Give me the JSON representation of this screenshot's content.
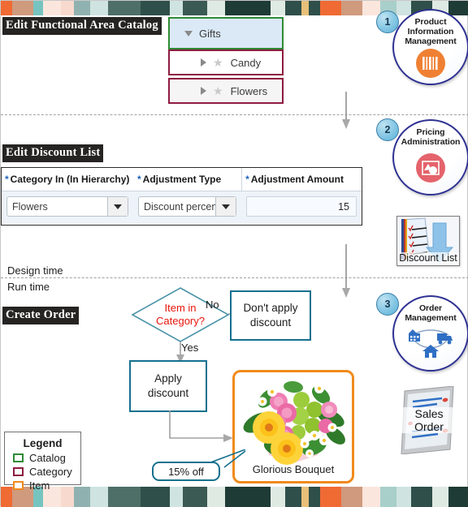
{
  "sections": {
    "catalog_heading": "Edit Functional Area Catalog",
    "discount_heading": "Edit Discount List",
    "order_heading": "Create Order",
    "design_time_label": "Design time",
    "run_time_label": "Run time"
  },
  "tree": {
    "rows": [
      {
        "label": "Gifts",
        "twisty": "down",
        "starred": false,
        "level": 0,
        "kind": "catalog"
      },
      {
        "label": "Candy",
        "twisty": "right",
        "starred": true,
        "level": 1,
        "kind": "category"
      },
      {
        "label": "Flowers",
        "twisty": "right",
        "starred": true,
        "level": 1,
        "kind": "category"
      }
    ]
  },
  "discount_table": {
    "columns": [
      {
        "required": "*",
        "label": "Category In (In Hierarchy)"
      },
      {
        "required": "*",
        "label": "Adjustment Type"
      },
      {
        "required": "*",
        "label": "Adjustment Amount"
      }
    ],
    "row": {
      "category": "Flowers",
      "adjustment_type": "Discount percent",
      "adjustment_amount": "15"
    }
  },
  "flow": {
    "decision": "Item in\nCategory?",
    "decision_line1": "Item in",
    "decision_line2": "Category?",
    "branch_no": "No",
    "branch_yes": "Yes",
    "box_no_line1": "Don't apply",
    "box_no_line2": "discount",
    "box_yes_line1": "Apply",
    "box_yes_line2": "discount",
    "callout": "15% off",
    "item_caption": "Glorious Bouquet"
  },
  "legend": {
    "title": "Legend",
    "entries": [
      {
        "label": "Catalog",
        "color": "#2e8b34"
      },
      {
        "label": "Category",
        "color": "#8e1b40"
      },
      {
        "label": "Item",
        "color": "#f08a1c"
      }
    ]
  },
  "rail": {
    "steps": [
      {
        "number": "1",
        "title_lines": [
          "Product",
          "Information",
          "Management"
        ],
        "icon": "barcode-icon",
        "icon_color": "#ef8033"
      },
      {
        "number": "2",
        "title_lines": [
          "Pricing",
          "Administration"
        ],
        "icon": "pricing-tag-icon",
        "icon_color": "#e4636c",
        "artifact": "Discount List"
      },
      {
        "number": "3",
        "title_lines": [
          "Order",
          "Management"
        ],
        "icon": "supply-chain-icon",
        "icon_color": "#2f6fc4",
        "artifact_lines": [
          "Sales",
          "Order"
        ]
      }
    ]
  },
  "colors": {
    "catalog_green": "#2e8b34",
    "category_maroon": "#8e1b40",
    "item_orange": "#f08a1c",
    "flow_teal": "#15708f",
    "decision_red": "#e8140a",
    "heading_bg": "#262423",
    "selected_row_bg": "#dbe9f6",
    "circle_border": "#2e3192"
  },
  "decor": {
    "band_colors": [
      "#f06a34",
      "#cf9a7e",
      "#76c4c0",
      "#fbe6dd",
      "#f9d9cd",
      "#8fb2b0",
      "#cfe3e0",
      "#4e6f68",
      "#2f4f4a",
      "#3b5a54",
      "#1f3b36",
      "#f06a34",
      "#c9d8cf",
      "#2f4f4a",
      "#e8c07a",
      "#f06a34",
      "#cf9a7e",
      "#fbe6dd",
      "#a9cfca",
      "#cfe3e0",
      "#2f4f4a",
      "#1f3b36",
      "#4e6f68",
      "#dfeae3"
    ]
  }
}
